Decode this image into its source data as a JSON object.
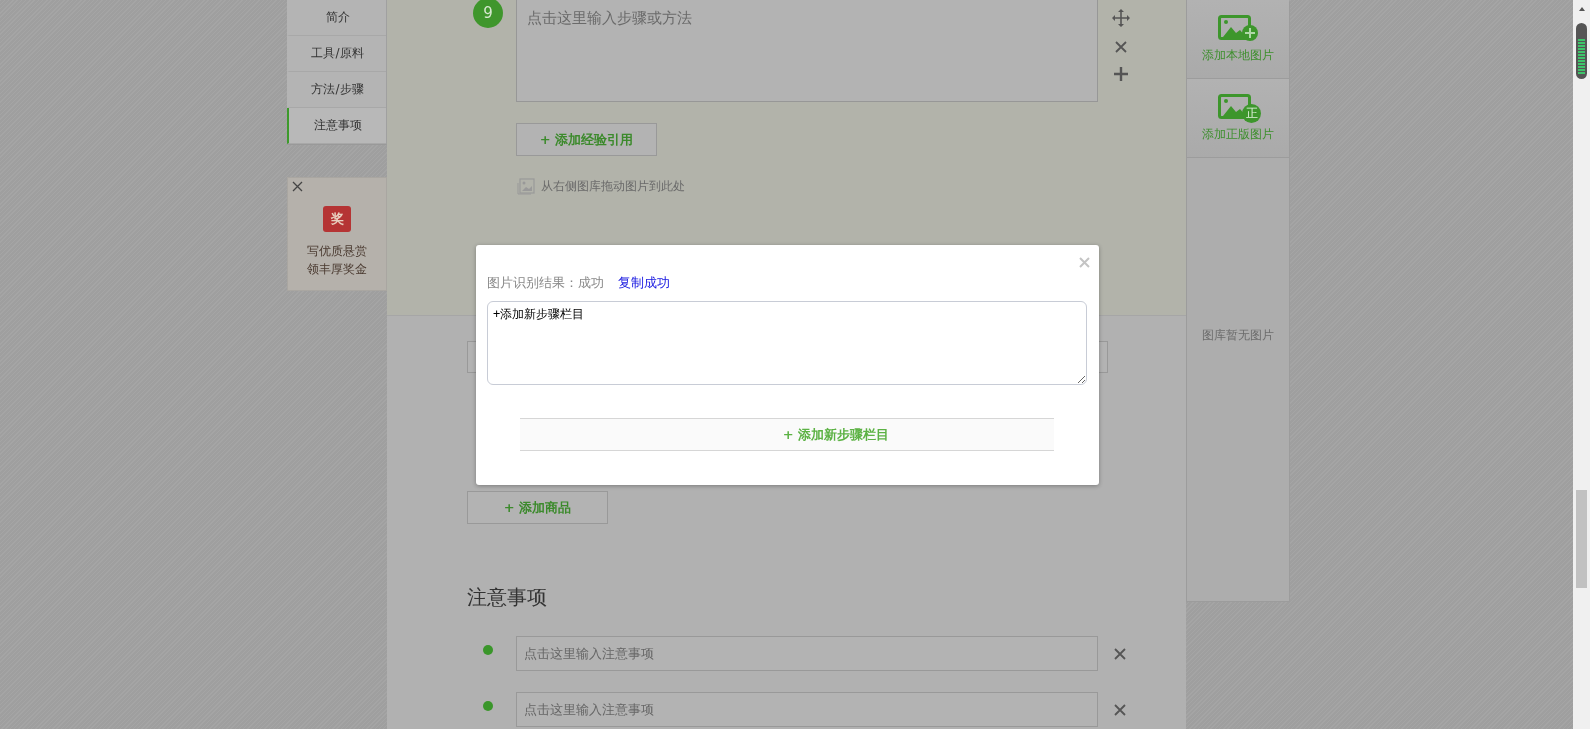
{
  "nav": {
    "items": [
      {
        "label": "简介",
        "selected": false
      },
      {
        "label": "工具/原料",
        "selected": false
      },
      {
        "label": "方法/步骤",
        "selected": false
      },
      {
        "label": "注意事项",
        "selected": true
      }
    ]
  },
  "promo": {
    "badge": "奖",
    "lines": [
      "写优质悬赏",
      "领丰厚奖金"
    ]
  },
  "step": {
    "number": "9",
    "placeholder": "点击这里输入步骤或方法",
    "cite_button": "+ 添加经验引用",
    "drop_hint": "从右侧图库拖动图片到此处"
  },
  "product_button": "+ 添加商品",
  "notes": {
    "heading": "注意事项",
    "items": [
      {
        "placeholder": "点击这里输入注意事项"
      },
      {
        "placeholder": "点击这里输入注意事项"
      }
    ]
  },
  "gallery": {
    "actions": [
      {
        "kind": "local",
        "label": "添加本地图片"
      },
      {
        "kind": "licensed",
        "badge": "正",
        "label": "添加正版图片"
      }
    ],
    "empty_text": "图库暂无图片"
  },
  "dialog": {
    "result_label": "图片识别结果：成功",
    "copy_link": "复制成功",
    "text": "+添加新步骤栏目",
    "add_button": "+ 添加新步骤栏目"
  }
}
